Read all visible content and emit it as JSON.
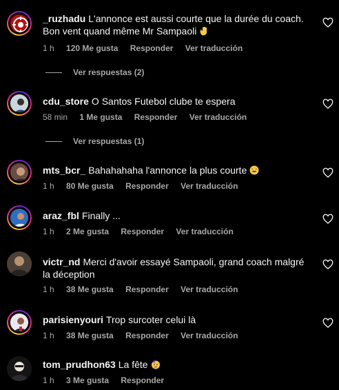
{
  "comments": [
    {
      "username": "_ruzhadu",
      "text": "L'annonce est aussi courte que la durée du coach. Bon vent quand même Mr Sampaoli",
      "time": "1 h",
      "likes": "120 Me gusta",
      "reply": "Responder",
      "translate": "Ver traducción",
      "replies": "Ver respuestas (2)"
    },
    {
      "username": "cdu_store",
      "text": "O Santos Futebol clube te espera",
      "time": "58 min",
      "likes": "1 Me gusta",
      "reply": "Responder",
      "translate": "Ver traducción",
      "replies": "Ver respuestas (1)"
    },
    {
      "username": "mts_bcr_",
      "text": "Bahahahaha l'annonce la plus courte",
      "time": "1 h",
      "likes": "80 Me gusta",
      "reply": "Responder",
      "translate": "Ver traducción"
    },
    {
      "username": "araz_fbl",
      "text": "Finally ...",
      "time": "1 h",
      "likes": "2 Me gusta",
      "reply": "Responder",
      "translate": "Ver traducción"
    },
    {
      "username": "victr_nd",
      "text": "Merci d'avoir essayé Sampaoli, grand coach malgré la déception",
      "time": "1 h",
      "likes": "38 Me gusta",
      "reply": "Responder",
      "translate": "Ver traducción"
    },
    {
      "username": "parisienyouri",
      "text": "Trop surcoter celui là",
      "time": "1 h",
      "likes": "38 Me gusta",
      "reply": "Responder",
      "translate": "Ver traducción"
    },
    {
      "username": "tom_prudhon63",
      "text": "La fête",
      "time": "1 h",
      "likes": "3 Me gusta",
      "reply": "Responder"
    }
  ]
}
